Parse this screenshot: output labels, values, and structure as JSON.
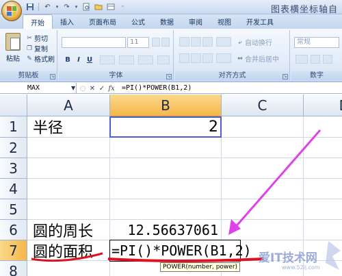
{
  "app": {
    "title": "图表横坐标轴自",
    "quick_access": [
      "save-icon",
      "undo-icon",
      "redo-icon",
      "print-preview-icon",
      "open-icon",
      "dropdown-icon"
    ]
  },
  "ribbon": {
    "tabs": [
      "开始",
      "插入",
      "页面布局",
      "公式",
      "数据",
      "审阅",
      "视图",
      "开发工具"
    ],
    "active_tab": "开始",
    "clipboard": {
      "paste": "粘贴",
      "cut": "剪切",
      "copy": "复制",
      "format_painter": "格式刷",
      "group_label": "剪贴板"
    },
    "font": {
      "size": "11",
      "group_label": "字体",
      "bold": "B",
      "italic": "I",
      "underline": "U"
    },
    "alignment": {
      "wrap": "自动换行",
      "merge": "合并后居中",
      "group_label": "对齐方式"
    },
    "number": {
      "format": "常规",
      "group_label": "数字"
    }
  },
  "formula_bar": {
    "name_box": "MAX",
    "formula": "=PI()*POWER(B1,2)"
  },
  "sheet": {
    "columns": [
      "A",
      "B",
      "C",
      "D"
    ],
    "rows": [
      "1",
      "2",
      "3",
      "4",
      "5",
      "6",
      "7",
      "8"
    ],
    "cells": {
      "A1": "半径",
      "B1": "2",
      "A6": "圆的周长",
      "B6": "12.56637061",
      "A7": "圆的面积",
      "B7": "=PI()*POWER(B1,2)"
    },
    "tooltip": "POWER(number, power)"
  },
  "watermark": {
    "text": "爱IT技术网",
    "sub": "www.52ij.com"
  },
  "colors": {
    "annotation_arrow": "#e040e8",
    "annotation_underline": "#e01020",
    "selection_border": "#4b5fd0",
    "header_selected": "#f5b649"
  }
}
